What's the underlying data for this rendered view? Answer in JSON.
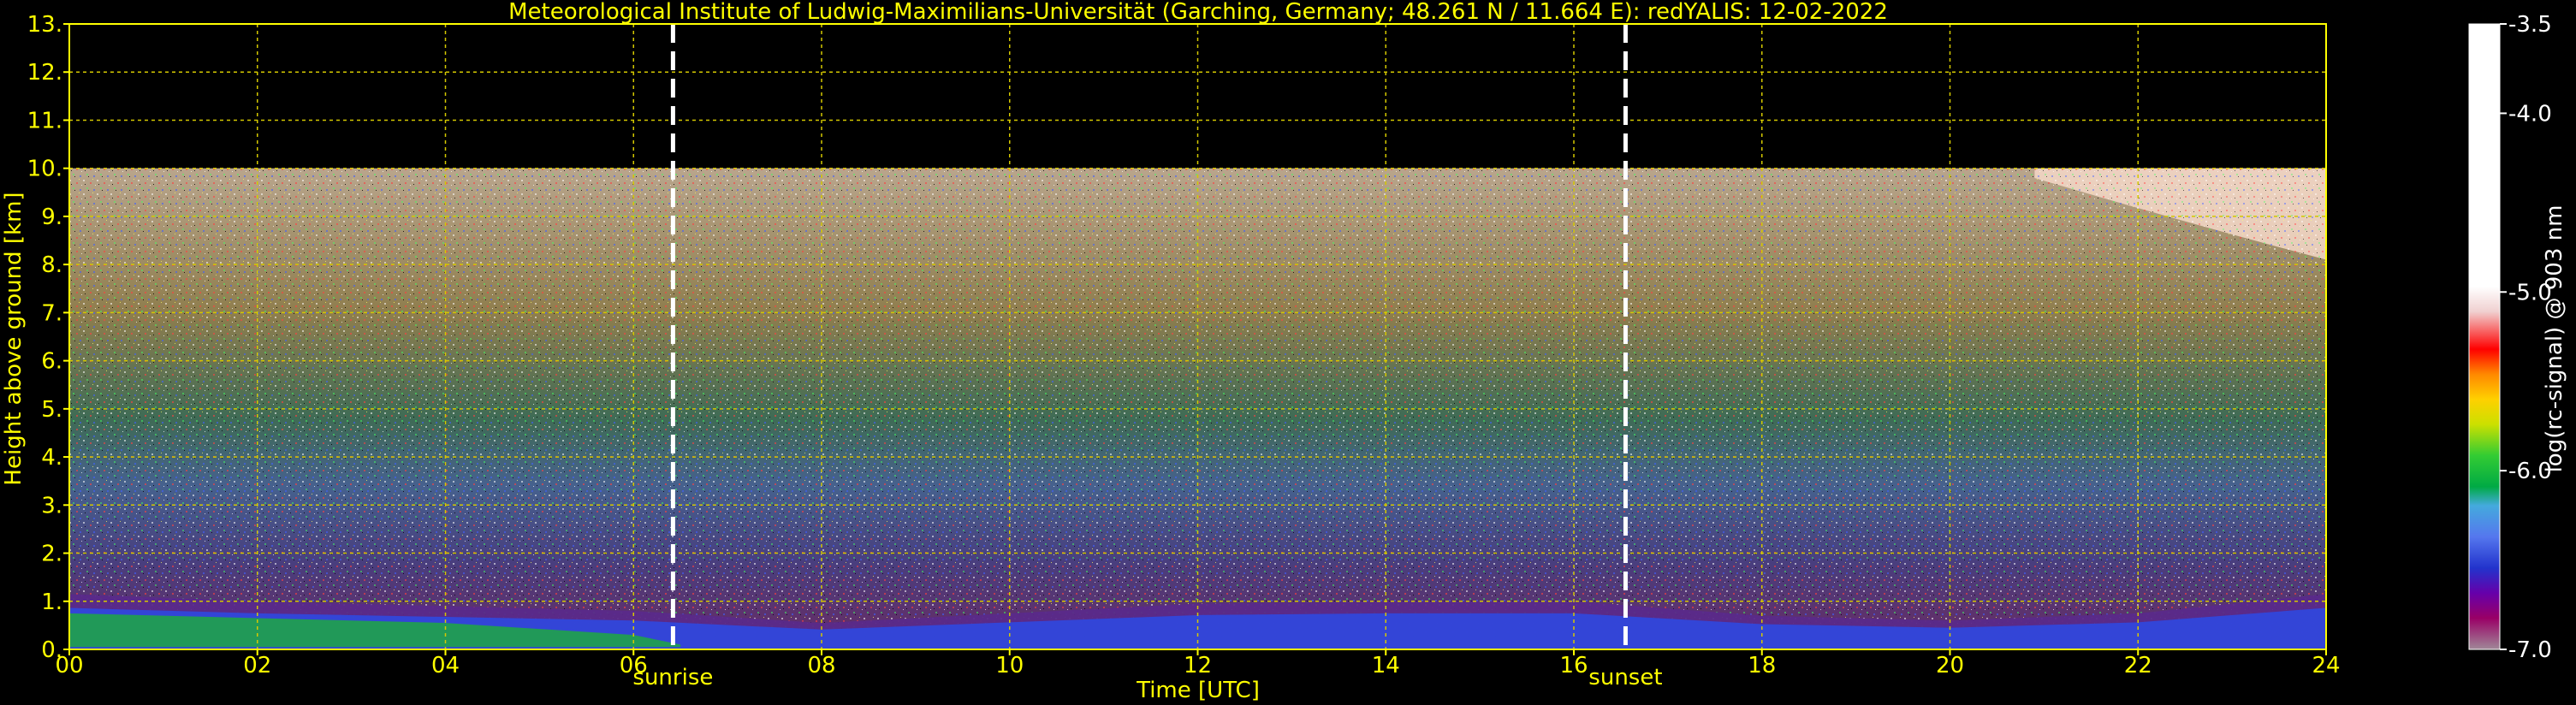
{
  "chart_data": {
    "type": "heatmap",
    "title": "Meteorological Institute of Ludwig-Maximilians-Universität (Garching, Germany; 48.261 N / 11.664 E):    redYALIS: 12-02-2022",
    "xlabel": "Time [UTC]",
    "ylabel": "Height above ground [km]",
    "xlim": [
      0,
      24
    ],
    "ylim": [
      0,
      13
    ],
    "x_ticks": [
      "00",
      "02",
      "04",
      "06",
      "08",
      "10",
      "12",
      "14",
      "16",
      "18",
      "20",
      "22",
      "24"
    ],
    "y_ticks": [
      "0.",
      "1.",
      "2.",
      "3.",
      "4.",
      "5.",
      "6.",
      "7.",
      "8.",
      "9.",
      "10.",
      "11.",
      "12.",
      "13."
    ],
    "grid": true,
    "data_top_km": 10,
    "events": [
      {
        "label": "sunrise",
        "time": 6.42
      },
      {
        "label": "sunset",
        "time": 16.55
      }
    ],
    "colorbar": {
      "label": "log(rc-signal) @ 903 nm",
      "range": [
        -7.0,
        -3.5
      ],
      "ticks": [
        "-3.5",
        "-4.0",
        "-5.0",
        "-6.0",
        "-7.0"
      ],
      "tick_values": [
        -3.5,
        -4.0,
        -5.0,
        -6.0,
        -7.0
      ]
    },
    "boundary_layer_top_km": [
      {
        "time": 0,
        "top": 1.15
      },
      {
        "time": 2,
        "top": 1.0
      },
      {
        "time": 4,
        "top": 0.9
      },
      {
        "time": 6,
        "top": 0.8
      },
      {
        "time": 8,
        "top": 0.55
      },
      {
        "time": 10,
        "top": 0.75
      },
      {
        "time": 12,
        "top": 0.95
      },
      {
        "time": 14,
        "top": 1.0
      },
      {
        "time": 16,
        "top": 1.0
      },
      {
        "time": 18,
        "top": 0.7
      },
      {
        "time": 20,
        "top": 0.6
      },
      {
        "time": 22,
        "top": 0.75
      },
      {
        "time": 24,
        "top": 1.15
      }
    ],
    "high_cloud": {
      "time_start": 20.9,
      "time_end": 24,
      "base_km": 8.1,
      "top_km": 10
    }
  },
  "colors": {
    "axis": "#ffff00",
    "grid": "#d4c800",
    "event_line": "#ffffff",
    "background": "#000000"
  }
}
